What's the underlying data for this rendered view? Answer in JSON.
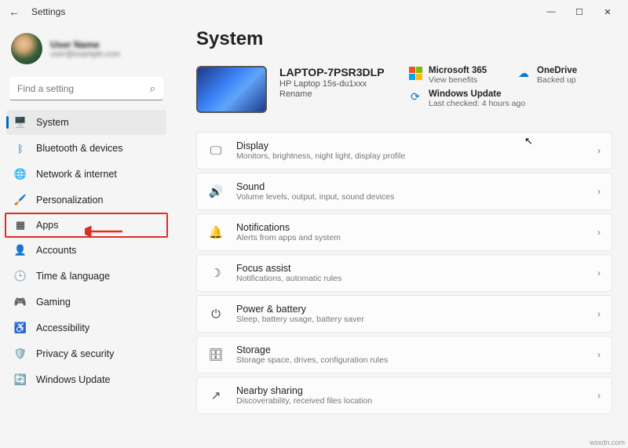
{
  "app_title": "Settings",
  "profile": {
    "name": "User Name",
    "email": "user@example.com"
  },
  "search": {
    "placeholder": "Find a setting"
  },
  "nav": [
    {
      "key": "system",
      "label": "System",
      "icon": "🖥️",
      "active": true
    },
    {
      "key": "bluetooth",
      "label": "Bluetooth & devices",
      "icon": "ᛒ",
      "color": "#0067c0"
    },
    {
      "key": "network",
      "label": "Network & internet",
      "icon": "🌐"
    },
    {
      "key": "personalization",
      "label": "Personalization",
      "icon": "🖌️"
    },
    {
      "key": "apps",
      "label": "Apps",
      "icon": "▦",
      "highlighted": true
    },
    {
      "key": "accounts",
      "label": "Accounts",
      "icon": "👤"
    },
    {
      "key": "time",
      "label": "Time & language",
      "icon": "🕒"
    },
    {
      "key": "gaming",
      "label": "Gaming",
      "icon": "🎮"
    },
    {
      "key": "accessibility",
      "label": "Accessibility",
      "icon": "♿"
    },
    {
      "key": "privacy",
      "label": "Privacy & security",
      "icon": "🛡️"
    },
    {
      "key": "update",
      "label": "Windows Update",
      "icon": "🔄",
      "color": "#0067c0"
    }
  ],
  "page_title": "System",
  "device": {
    "name": "LAPTOP-7PSR3DLP",
    "model": "HP Laptop 15s-du1xxx",
    "rename": "Rename"
  },
  "tiles": {
    "m365": {
      "title": "Microsoft 365",
      "sub": "View benefits"
    },
    "onedrive": {
      "title": "OneDrive",
      "sub": "Backed up"
    },
    "update": {
      "title": "Windows Update",
      "sub": "Last checked: 4 hours ago"
    }
  },
  "cards": [
    {
      "key": "display",
      "icon": "🖵",
      "title": "Display",
      "sub": "Monitors, brightness, night light, display profile"
    },
    {
      "key": "sound",
      "icon": "🔊",
      "title": "Sound",
      "sub": "Volume levels, output, input, sound devices"
    },
    {
      "key": "notifications",
      "icon": "🔔",
      "title": "Notifications",
      "sub": "Alerts from apps and system"
    },
    {
      "key": "focus",
      "icon": "☽",
      "title": "Focus assist",
      "sub": "Notifications, automatic rules"
    },
    {
      "key": "power",
      "icon": "⏻",
      "title": "Power & battery",
      "sub": "Sleep, battery usage, battery saver"
    },
    {
      "key": "storage",
      "icon": "🗄",
      "title": "Storage",
      "sub": "Storage space, drives, configuration rules"
    },
    {
      "key": "nearby",
      "icon": "↗",
      "title": "Nearby sharing",
      "sub": "Discoverability, received files location"
    }
  ],
  "watermark": "wsxdn.com"
}
